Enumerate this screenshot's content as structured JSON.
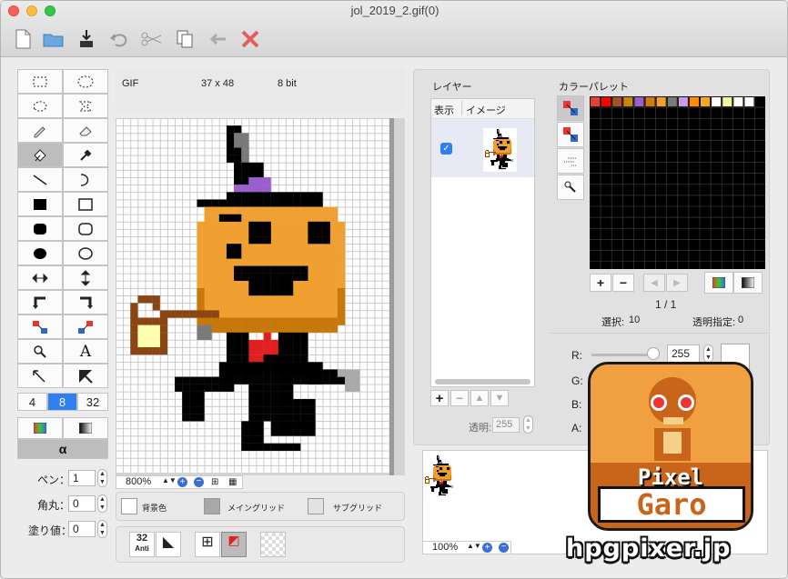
{
  "window": {
    "title": "jol_2019_2.gif(0)"
  },
  "toolbar": {
    "icons": [
      "new-doc-icon",
      "open-folder-icon",
      "save-icon",
      "undo-icon",
      "cut-icon",
      "copy-icon",
      "paste-icon",
      "delete-icon"
    ]
  },
  "info": {
    "format": "GIF",
    "dimensions": "37 x 48",
    "depth": "8 bit"
  },
  "tools": {
    "icons": [
      "rect-select-icon",
      "ellipse-select-icon",
      "lasso-icon",
      "polygon-select-icon",
      "pencil-icon",
      "eraser-icon",
      "bucket-icon",
      "eyedropper-icon",
      "line-icon",
      "curve-icon",
      "filled-rect-icon",
      "rect-icon",
      "filled-rounded-rect-icon",
      "rounded-rect-icon",
      "filled-ellipse-icon",
      "ellipse-icon",
      "flip-horizontal-icon",
      "flip-vertical-icon",
      "rotate-left-icon",
      "rotate-right-icon",
      "swap-color-icon",
      "replace-color-icon",
      "zoom-icon",
      "text-icon",
      "move-icon",
      "select-arrow-icon"
    ],
    "sizes": [
      "4",
      "8",
      "32"
    ],
    "selected_size": "8",
    "alpha_label": "α"
  },
  "options": {
    "pen_label": "ペン：",
    "pen_value": "1",
    "round_label": "角丸：",
    "round_value": "0",
    "fill_label": "塗り値：",
    "fill_value": "0"
  },
  "canvas_status": {
    "zoom": "800%",
    "bg_label": "背景色",
    "main_grid_label": "メイングリッド",
    "sub_grid_label": "サブグリッド",
    "anti_label": "Anti",
    "anti_value": "32"
  },
  "layers": {
    "title": "レイヤー",
    "col_show": "表示",
    "col_image": "イメージ",
    "opacity_label": "透明:",
    "opacity_value": "255",
    "preview_zoom": "100%"
  },
  "palette": {
    "title": "カラーパレット",
    "page": "1 / 1",
    "selected_label": "選択:",
    "selected_value": "10",
    "transparent_label": "透明指定:",
    "transparent_value": "0",
    "swatches": [
      "#e84030",
      "#ff0000",
      "#a0522d",
      "#c8860a",
      "#9a5ecf",
      "#d07a10",
      "#f0a030",
      "#7a7a7a",
      "#c89ae8",
      "#ff8c00",
      "#f5a623",
      "#ffffff",
      "#f7f7a0",
      "#fffff0",
      "#ffffff"
    ],
    "r_label": "R:",
    "r_value": "255",
    "g_label": "G:",
    "b_label": "B:",
    "a_label": "A:"
  },
  "logo": {
    "line1": "Pixel",
    "line2": "Garo"
  },
  "watermark": "hpgpixer.jp"
}
